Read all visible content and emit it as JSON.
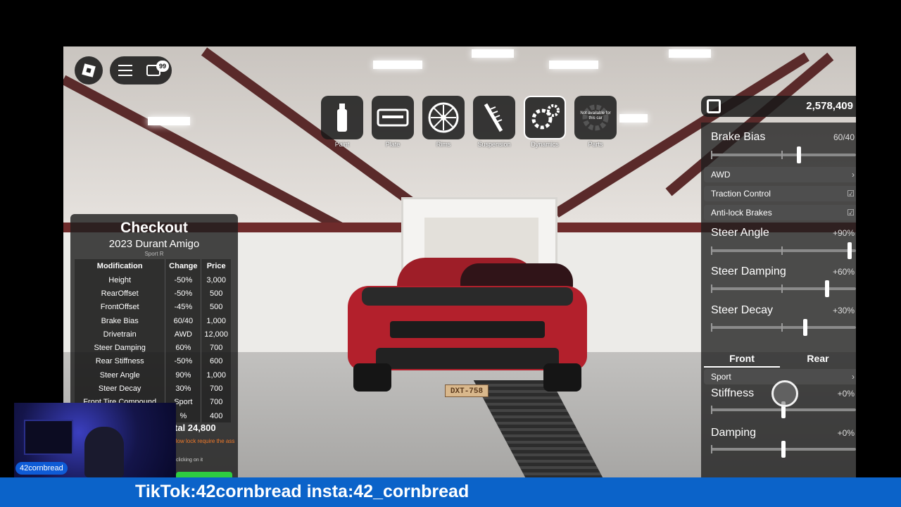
{
  "hud": {
    "chat_badge": "99",
    "currency": "2,578,409"
  },
  "toolbar": [
    {
      "label": "Paint",
      "icon": "spray-can-icon"
    },
    {
      "label": "Plate",
      "icon": "license-plate-icon"
    },
    {
      "label": "Rims",
      "icon": "rim-icon"
    },
    {
      "label": "Suspension",
      "icon": "suspension-icon"
    },
    {
      "label": "Dynamics",
      "icon": "gears-icon",
      "active": true
    },
    {
      "label": "Parts",
      "icon": "gear-icon",
      "note": "Not available for this car"
    }
  ],
  "tuning": {
    "brake_bias": {
      "label": "Brake Bias",
      "value": "60/40"
    },
    "drivetrain": {
      "label": "AWD"
    },
    "traction": {
      "label": "Traction Control"
    },
    "abs": {
      "label": "Anti-lock Brakes"
    },
    "steer_angle": {
      "label": "Steer Angle",
      "value": "+90%"
    },
    "steer_damping": {
      "label": "Steer Damping",
      "value": "+60%"
    },
    "steer_decay": {
      "label": "Steer Decay",
      "value": "+30%"
    },
    "tabs": {
      "front": "Front",
      "rear": "Rear"
    },
    "compound": {
      "label": "Sport"
    },
    "stiffness": {
      "label": "Stiffness",
      "value": "+0%"
    },
    "damping": {
      "label": "Damping",
      "value": "+0%"
    }
  },
  "checkout": {
    "title": "Checkout",
    "car": "2023 Durant Amigo",
    "trim": "Sport R",
    "columns": [
      "Modification",
      "Change",
      "Price"
    ],
    "rows": [
      [
        "Height",
        "-50%",
        "3,000"
      ],
      [
        "RearOffset",
        "-50%",
        "500"
      ],
      [
        "FrontOffset",
        "-45%",
        "500"
      ],
      [
        "Brake Bias",
        "60/40",
        "1,000"
      ],
      [
        "Drivetrain",
        "AWD",
        "12,000"
      ],
      [
        "Steer Damping",
        "60%",
        "700"
      ],
      [
        "Rear Stiffness",
        "-50%",
        "600"
      ],
      [
        "Steer Angle",
        "90%",
        "1,000"
      ],
      [
        "Steer Decay",
        "30%",
        "700"
      ],
      [
        "Front Tire Compound",
        "Sport",
        "700"
      ],
      [
        "",
        "%",
        "400"
      ]
    ],
    "total": "tal 24,800",
    "note": "llow lock require the ass",
    "note2": "clicking on it"
  },
  "car": {
    "plate": "DXT-758"
  },
  "stream": {
    "username": "42cornbread",
    "banner": "TikTok:42cornbread insta:42_cornbread"
  }
}
